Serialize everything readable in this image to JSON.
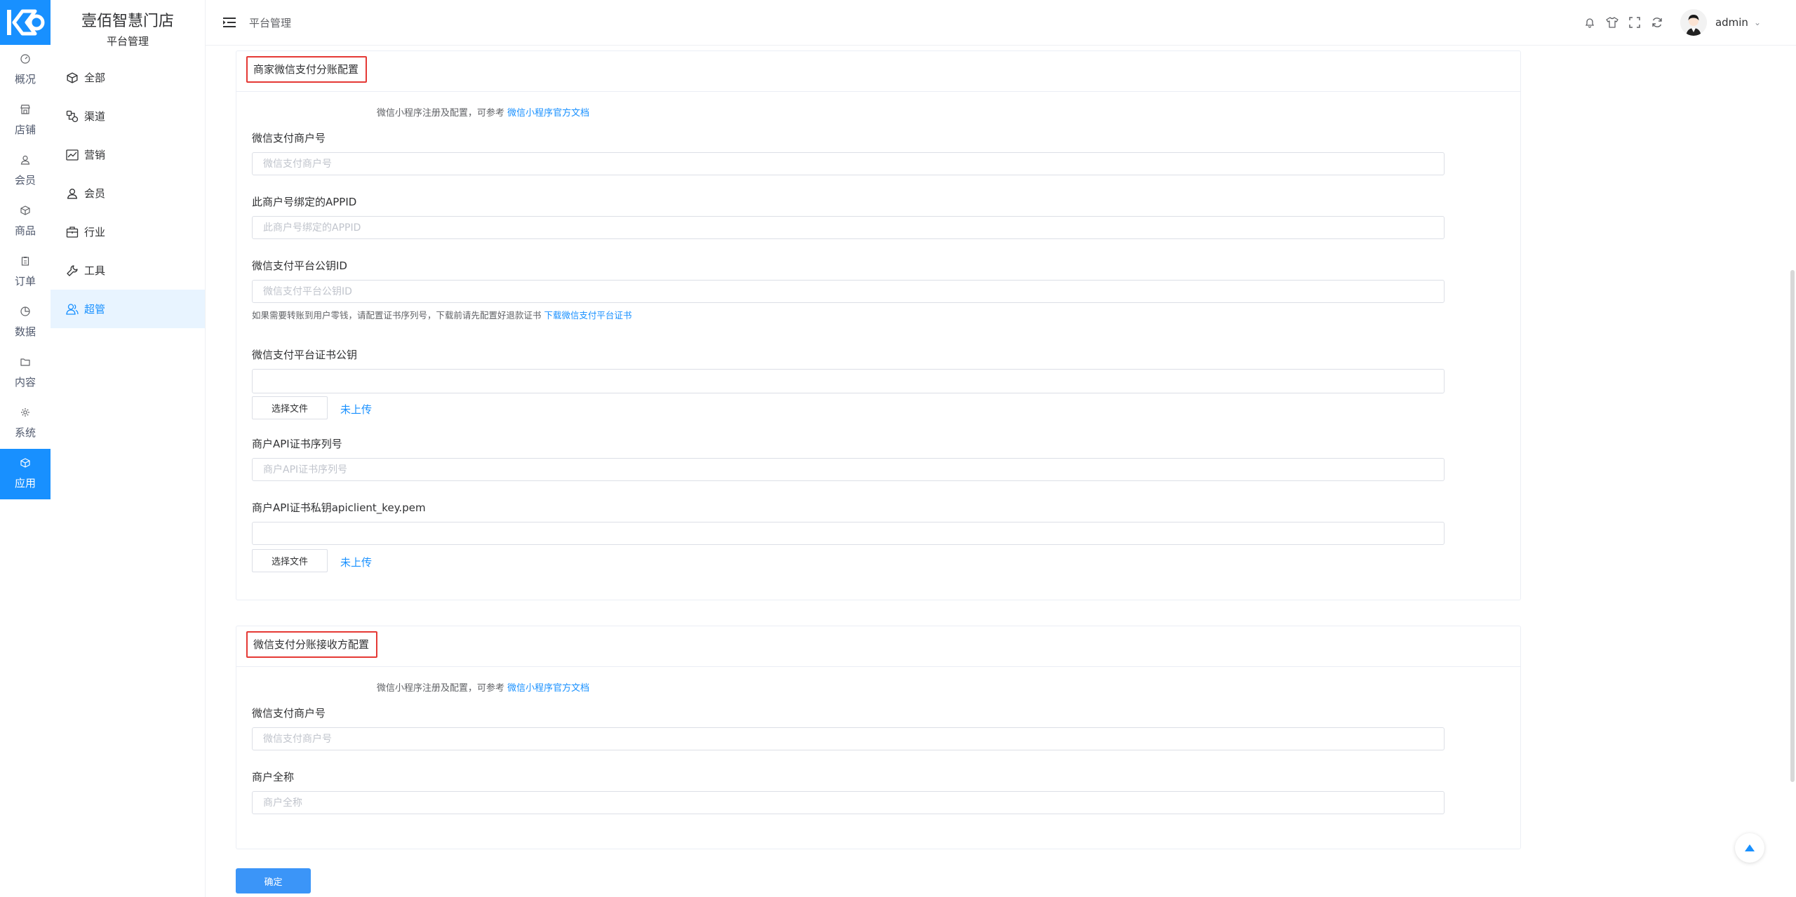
{
  "app": {
    "store_name": "壹佰智慧门店",
    "store_sub": "平台管理"
  },
  "rail": [
    {
      "label": "概况",
      "icon": "dashboard-icon"
    },
    {
      "label": "店铺",
      "icon": "store-icon"
    },
    {
      "label": "会员",
      "icon": "user-icon"
    },
    {
      "label": "商品",
      "icon": "box-icon"
    },
    {
      "label": "订单",
      "icon": "clipboard-icon"
    },
    {
      "label": "数据",
      "icon": "pie-chart-icon"
    },
    {
      "label": "内容",
      "icon": "folder-icon"
    },
    {
      "label": "系统",
      "icon": "gear-icon"
    },
    {
      "label": "应用",
      "icon": "cube-icon",
      "active": true
    }
  ],
  "menu": [
    {
      "label": "全部",
      "icon": "cube-icon"
    },
    {
      "label": "渠道",
      "icon": "channel-icon"
    },
    {
      "label": "营销",
      "icon": "trend-icon"
    },
    {
      "label": "会员",
      "icon": "user-icon"
    },
    {
      "label": "行业",
      "icon": "briefcase-icon"
    },
    {
      "label": "工具",
      "icon": "wrench-icon"
    },
    {
      "label": "超管",
      "icon": "admin-users-icon",
      "active": true
    }
  ],
  "header": {
    "breadcrumb": "平台管理",
    "user": "admin",
    "icons": [
      "bell-icon",
      "shirt-icon",
      "fullscreen-icon",
      "refresh-icon"
    ]
  },
  "section1": {
    "title": "商家微信支付分账配置",
    "help_text": "微信小程序注册及配置，可参考",
    "help_link": "微信小程序官方文档",
    "merchant_id_label": "微信支付商户号",
    "merchant_id_placeholder": "微信支付商户号",
    "appid_label": "此商户号绑定的APPID",
    "appid_placeholder": "此商户号绑定的APPID",
    "platform_key_id_label": "微信支付平台公钥ID",
    "platform_key_id_placeholder": "微信支付平台公钥ID",
    "platform_key_note": "如果需要转账到用户零钱，请配置证书序列号，下载前请先配置好退款证书",
    "platform_key_note_link": "下载微信支付平台证书",
    "platform_cert_label": "微信支付平台证书公钥",
    "platform_cert_value": "",
    "file_button": "选择文件",
    "file_status": "未上传",
    "api_serial_label": "商户API证书序列号",
    "api_serial_placeholder": "商户API证书序列号",
    "api_key_label": "商户API证书私钥apiclient_key.pem",
    "api_key_value": "",
    "file_button_2": "选择文件",
    "file_status_2": "未上传"
  },
  "section2": {
    "title": "微信支付分账接收方配置",
    "help_text": "微信小程序注册及配置，可参考",
    "help_link": "微信小程序官方文档",
    "merchant_id_label": "微信支付商户号",
    "merchant_id_placeholder": "微信支付商户号",
    "full_name_label": "商户全称",
    "full_name_placeholder": "商户全称"
  },
  "submit_label": "确定",
  "colors": {
    "accent": "#1890ff",
    "highlight_border": "#e53935"
  }
}
